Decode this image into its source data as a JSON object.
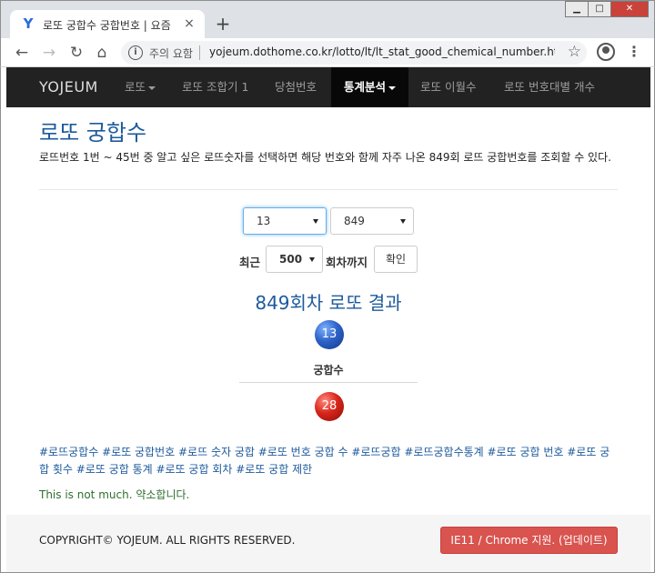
{
  "browser": {
    "tab_title": "로또 궁합수 궁합번호 | 요즘",
    "tab_close": "×",
    "new_tab": "+",
    "security_text": "주의 요함",
    "url": "yojeum.dothome.co.kr/lotto/lt/lt_stat_good_chemical_number.html...",
    "window_buttons": {
      "minimize": "▁",
      "maximize": "□",
      "close": "✕"
    }
  },
  "navbar": {
    "brand": "YOJEUM",
    "items": [
      {
        "label": "로또"
      },
      {
        "label": "로또 조합기 1"
      },
      {
        "label": "당첨번호"
      },
      {
        "label": "통계분석"
      },
      {
        "label": "로또 이월수"
      },
      {
        "label": "로또 번호대별 개수"
      }
    ]
  },
  "main": {
    "title": "로또 궁합수",
    "description": "로뜨번호 1번 ~ 45번 중 알고 싶은 로뜨숫자를 선택하면 해당 번호와 함께 자주 나온 849회 로뜨 궁합번호를 조회할 수 있다.",
    "form": {
      "number_select": "13",
      "round_select": "849",
      "recent_label": "최근",
      "recent_select": "500",
      "until_label": "회차까지",
      "confirm_button": "확인"
    },
    "result_title": "849회차 로또 결과",
    "selected_ball": "13",
    "chemistry_label": "궁합수",
    "chemistry_ball": "28",
    "tags": "#로뜨궁합수 #로또 궁합번호 #로뜨 숫자 궁합 #로또 번호 궁합 수 #로뜨궁합 #로뜨궁합수통계 #로또 궁합 번호 #로또 궁합 횟수 #로또 궁합 통계 #로또 궁합 회차 #로또 궁합 제한",
    "note": "This is not much. 약소합니다."
  },
  "footer": {
    "copyright": "COPYRIGHT© YOJEUM. ALL RIGHTS RESERVED.",
    "update_button": "IE11 / Chrome 지원. (업데이트)"
  },
  "colors": {
    "accent_blue": "#1d5a9c",
    "navbar_bg": "#222222",
    "update_red": "#d9534f",
    "ball_blue": "#2d62c8",
    "ball_red": "#d8261b"
  }
}
